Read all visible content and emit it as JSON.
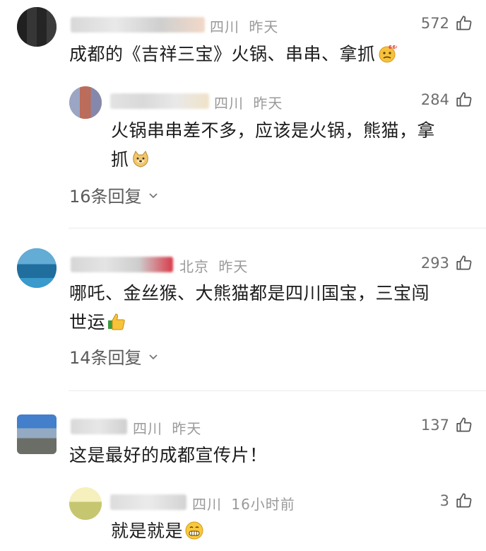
{
  "comments": [
    {
      "location": "四川",
      "time": "昨天",
      "likes": "572",
      "text": "成都的《吉祥三宝》火锅、串串、拿抓",
      "emoji": "thinking-666-emoji",
      "reply": {
        "location": "四川",
        "time": "昨天",
        "likes": "284",
        "text_line1": "火锅串串差不多，应该是火锅，熊猫，拿",
        "text_line2": "抓",
        "emoji": "doge-emoji"
      },
      "replies_label": "16条回复"
    },
    {
      "location": "北京",
      "time": "昨天",
      "likes": "293",
      "text_line1": "哪吒、金丝猴、大熊猫都是四川国宝，三宝闯",
      "text_line2": "世运",
      "emoji": "thumbs-up-emoji",
      "replies_label": "14条回复"
    },
    {
      "location": "四川",
      "time": "昨天",
      "likes": "137",
      "text": "这是最好的成都宣传片！",
      "reply": {
        "location": "四川",
        "time": "16小时前",
        "likes": "3",
        "text": "就是就是",
        "emoji": "grinning-emoji"
      }
    }
  ],
  "colors": {
    "meta_gray": "#9a9a9a",
    "text": "#1c1c1c",
    "divider": "#ececec"
  }
}
